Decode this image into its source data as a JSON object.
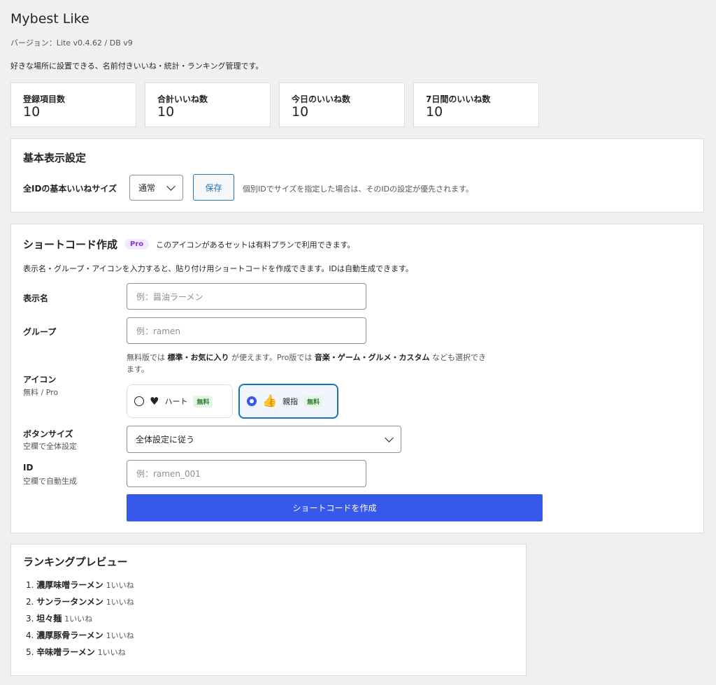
{
  "header": {
    "title": "Mybest Like",
    "version": "バージョン：Lite v0.4.62 / DB v9",
    "description": "好きな場所に設置できる、名前付きいいね・統計・ランキング管理です。"
  },
  "stats": [
    {
      "label": "登録項目数",
      "value": "10"
    },
    {
      "label": "合計いいね数",
      "value": "10"
    },
    {
      "label": "今日のいいね数",
      "value": "10"
    },
    {
      "label": "7日間のいいね数",
      "value": "10"
    }
  ],
  "basic": {
    "heading": "基本表示設定",
    "size_label": "全IDの基本いいねサイズ",
    "size_value": "通常",
    "save_label": "保存",
    "note": "個別IDでサイズを指定した場合は、そのIDの設定が優先されます。"
  },
  "shortcode": {
    "heading": "ショートコード作成",
    "pro_badge": "Pro",
    "pro_note": "このアイコンがあるセットは有料プランで利用できます。",
    "intro": "表示名・グループ・アイコンを入力すると、貼り付け用ショートコードを作成できます。IDは自動生成できます。",
    "name_label": "表示名",
    "name_placeholder": "例：醤油ラーメン",
    "group_label": "グループ",
    "group_placeholder": "例：ramen",
    "icon_help": {
      "t1": "無料版では ",
      "b1": "標準・お気に入り",
      "t2": " が使えます。Pro版では ",
      "b2": "音楽・ゲーム・グルメ・カスタム",
      "t3": " なども選択でき",
      "t4": "ます。"
    },
    "icon_label": "アイコン",
    "icon_sublabel": "無料 / Pro",
    "icons": [
      {
        "glyph": "♥",
        "name": "ハート",
        "badge": "無料",
        "selected": false
      },
      {
        "glyph": "👍",
        "name": "親指",
        "badge": "無料",
        "selected": true
      }
    ],
    "button_size_label": "ボタンサイズ",
    "button_size_sublabel": "空欄で全体設定",
    "button_size_value": "全体設定に従う",
    "id_label": "ID",
    "id_sublabel": "空欄で自動生成",
    "id_placeholder": "例：ramen_001",
    "create_label": "ショートコードを作成"
  },
  "ranking": {
    "heading": "ランキングプレビュー",
    "items": [
      {
        "num": "1.",
        "name": "濃厚味噌ラーメン",
        "count": "1いいね"
      },
      {
        "num": "2.",
        "name": "サンラータンメン",
        "count": "1いいね"
      },
      {
        "num": "3.",
        "name": "坦々麺",
        "count": "1いいね"
      },
      {
        "num": "4.",
        "name": "濃厚豚骨ラーメン",
        "count": "1いいね"
      },
      {
        "num": "5.",
        "name": "辛味噌ラーメン",
        "count": "1いいね"
      }
    ]
  },
  "colors": {
    "accent": "#3858e9",
    "link": "#2271b1",
    "pro": "#7e3bd0",
    "free": "#2e7d32"
  }
}
